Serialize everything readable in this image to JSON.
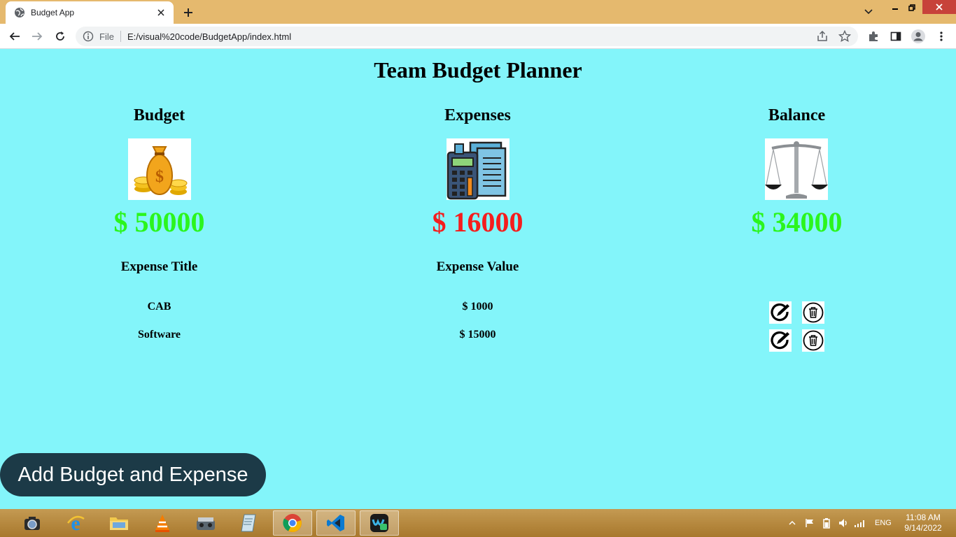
{
  "browser": {
    "tab_title": "Budget App",
    "address_scheme": "File",
    "address_url": "E:/visual%20code/BudgetApp/index.html"
  },
  "app": {
    "title": "Team Budget Planner",
    "budget": {
      "label": "Budget",
      "amount": "$ 50000",
      "icon": "money-bag-icon",
      "color": "#2bf51d"
    },
    "expenses": {
      "label": "Expenses",
      "amount": "$ 16000",
      "icon": "calculator-icon",
      "color": "#f51d1d"
    },
    "balance": {
      "label": "Balance",
      "amount": "$ 34000",
      "icon": "scale-icon",
      "color": "#2bf51d"
    },
    "table": {
      "headers": [
        "Expense Title",
        "Expense Value"
      ],
      "rows": [
        {
          "title": "CAB",
          "value": "$ 1000"
        },
        {
          "title": "Software",
          "value": "$ 15000"
        }
      ]
    },
    "add_button_label": "Add Budget and Expense"
  },
  "taskbar": {
    "language": "ENG",
    "time": "11:08 AM",
    "date": "9/14/2022"
  },
  "colors": {
    "page_background": "#83f5fa",
    "button_background": "#1c3a47",
    "tab_strip": "#e5b96e"
  }
}
